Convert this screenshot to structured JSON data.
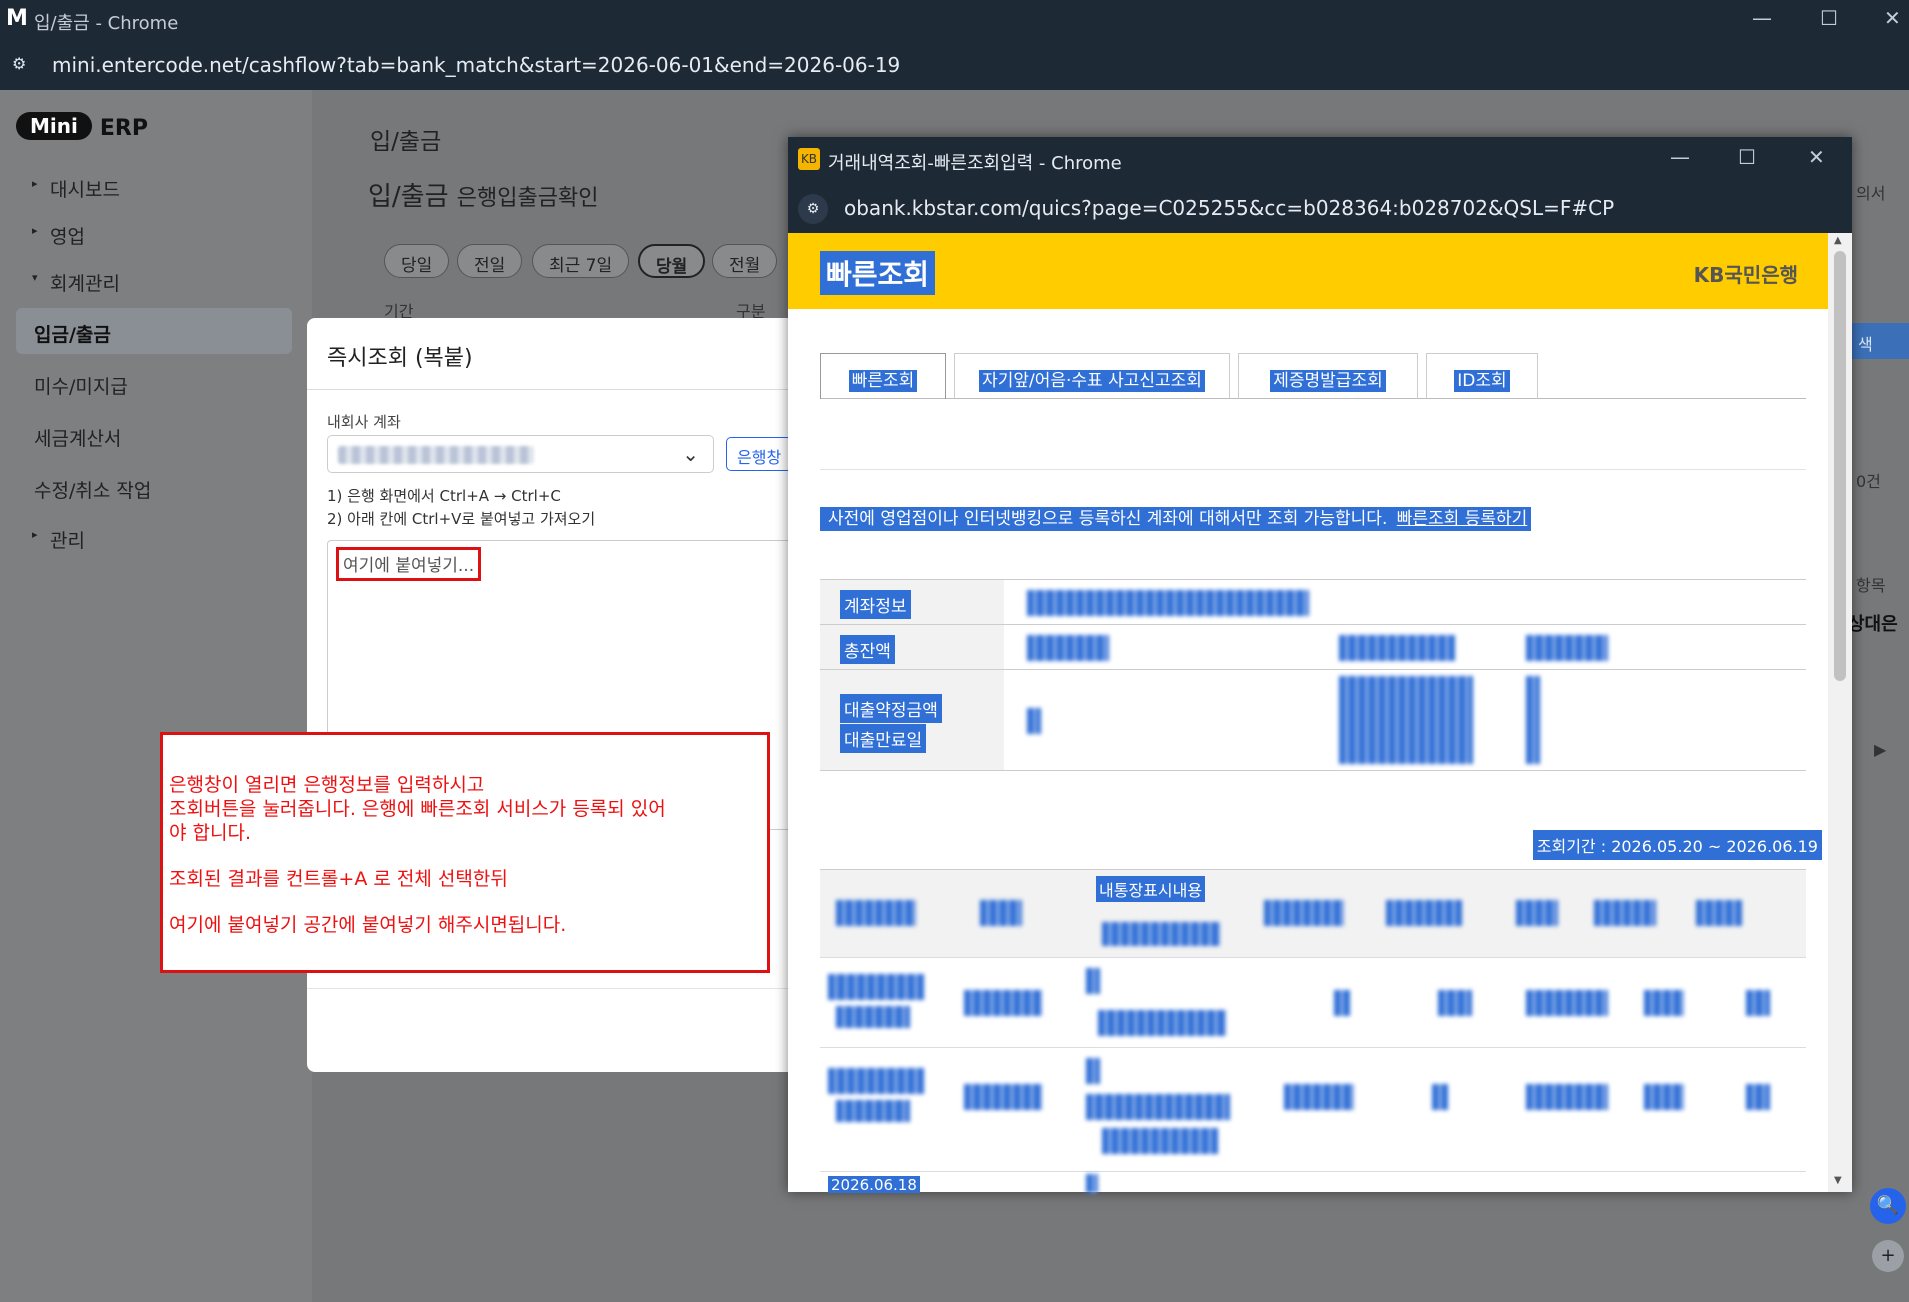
{
  "window": {
    "title": "입/출금 - Chrome",
    "url": "mini.entercode.net/cashflow?tab=bank_match&start=2026-06-01&end=2026-06-19"
  },
  "brand": {
    "mini": "Mini",
    "erp": "ERP"
  },
  "sidebar": {
    "items": [
      {
        "label": "대시보드",
        "caret": "▸"
      },
      {
        "label": "영업",
        "caret": "▸"
      },
      {
        "label": "회계관리",
        "caret": "▾"
      },
      {
        "label": "입금/출금",
        "caret": ""
      },
      {
        "label": "미수/미지급",
        "caret": ""
      },
      {
        "label": "세금계산서",
        "caret": ""
      },
      {
        "label": "수정/취소 작업",
        "caret": ""
      },
      {
        "label": "관리",
        "caret": "▸"
      }
    ]
  },
  "page": {
    "title": "입/출금",
    "subtitle_main": "입/출금",
    "subtitle_sub": "은행입출금확인",
    "period_label": "기간",
    "type_label": "구분",
    "filters": [
      "당일",
      "전일",
      "최근 7일",
      "당월",
      "전월"
    ]
  },
  "modal": {
    "title": "즉시조회 (복붙)",
    "account_label": "내회사 계좌",
    "bank_button": "은행창",
    "step1": "1) 은행 화면에서 Ctrl+A → Ctrl+C",
    "step2": "2) 아래 칸에 Ctrl+V로 붙여넣고 가져오기",
    "paste_placeholder": "여기에 붙여넣기..."
  },
  "note": {
    "line1": "은행창이 열리면 은행정보를 입력하시고",
    "line2": "조회버튼을 눌러줍니다. 은행에 빠른조회 서비스가 등록되 있어",
    "line3": "야 합니다.",
    "line4": "조회된 결과를 컨트롤+A 로 전체 선택한뒤",
    "line5": "여기에 붙여넣기 공간에 붙여넣기 해주시면됩니다."
  },
  "popup": {
    "title": "거래내역조회-빠른조회입력 - Chrome",
    "url": "obank.kbstar.com/quics?page=C025255&cc=b028364:b028702&QSL=F#CP",
    "heading": "빠른조회",
    "bank_logo": "KB국민은행",
    "tabs": [
      "빠른조회",
      "자기앞/어음·수표 사고신고조회",
      "제증명발급조회",
      "ID조회"
    ],
    "notice": "사전에 영업점이나 인터넷뱅킹으로 등록하신 계좌에 대해서만 조회 가능합니다.",
    "notice_link": "빠른조회 등록하기",
    "account_info": "계좌정보",
    "total_balance": "총잔액",
    "loan_limit": "대출약정금액",
    "loan_due": "대출만료일",
    "period": "조회기간 : 2026.05.20 ~ 2026.06.19",
    "col_memo": "내통장표시내용",
    "row_date_partial": "2026.06.18"
  },
  "right_clip": {
    "doc": "의서",
    "search": "색",
    "count": "0건",
    "item": "항목",
    "party": "상대은"
  }
}
